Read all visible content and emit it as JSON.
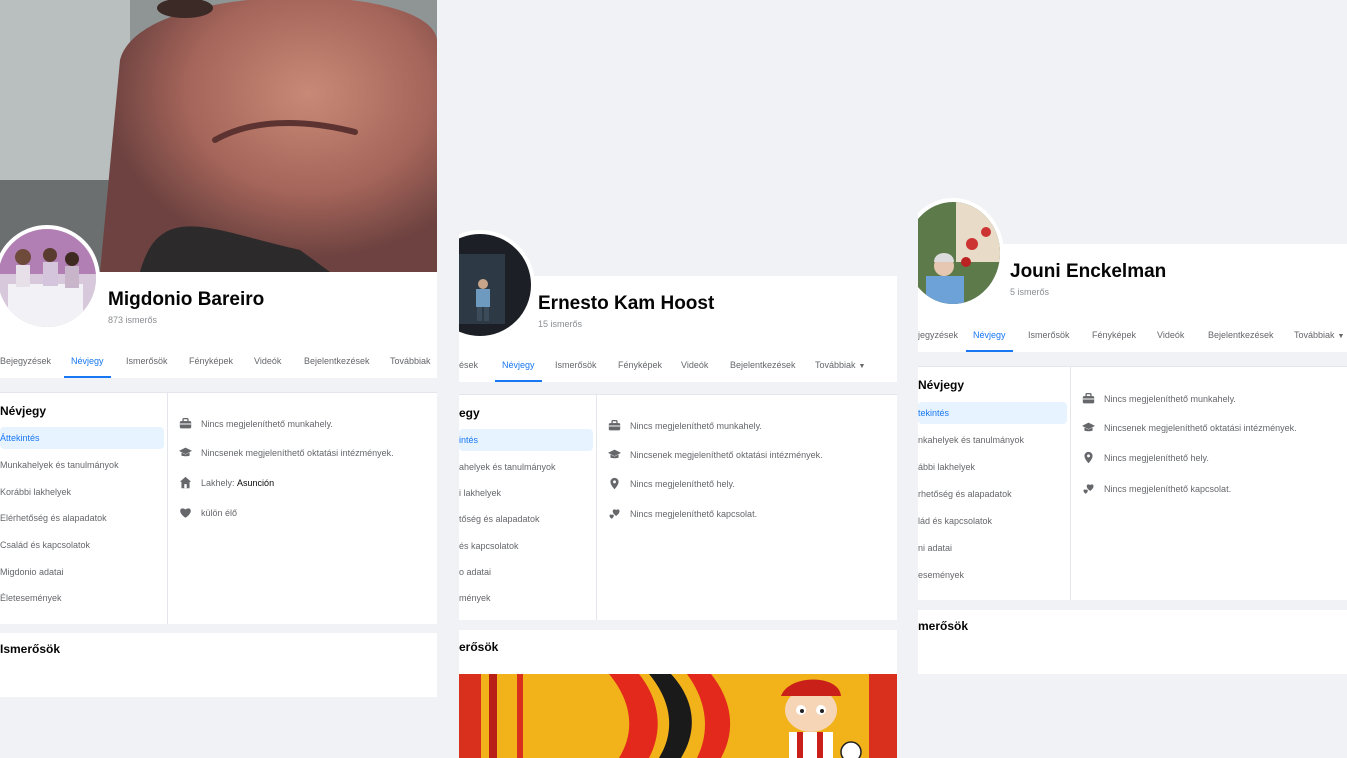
{
  "profiles": [
    {
      "name": "Migdonio Bareiro",
      "friends_count": "873 ismerős",
      "tabs": [
        "Bejegyzések",
        "Névjegy",
        "Ismerősök",
        "Fényképek",
        "Videók",
        "Bejelentkezések",
        "Továbbiak"
      ],
      "about_title": "Névjegy",
      "side_items": [
        "Áttekintés",
        "Munkahelyek és tanulmányok",
        "Korábbi lakhelyek",
        "Elérhetőség és alapadatok",
        "Család és kapcsolatok",
        "Migdonio adatai",
        "Életesemények"
      ],
      "info": [
        {
          "icon": "briefcase-icon",
          "text": "Nincs megjeleníthető munkahely."
        },
        {
          "icon": "graduation-cap-icon",
          "text": "Nincsenek megjeleníthető oktatási intézmények."
        },
        {
          "icon": "home-icon",
          "text": "Lakhely:",
          "value": "Asunción"
        },
        {
          "icon": "heart-icon",
          "text": "külön élő"
        }
      ],
      "friends_section": "Ismerősök"
    },
    {
      "name": "Ernesto Kam Hoost",
      "friends_count": "15 ismerős",
      "tabs": [
        "ések",
        "Névjegy",
        "Ismerősök",
        "Fényképek",
        "Videók",
        "Bejelentkezések",
        "Továbbiak"
      ],
      "about_title": "egy",
      "side_items": [
        "intés",
        "ahelyek és tanulmányok",
        "i lakhelyek",
        "tőség és alapadatok",
        "és kapcsolatok",
        "o adatai",
        "mények"
      ],
      "info": [
        {
          "icon": "briefcase-icon",
          "text": "Nincs megjeleníthető munkahely."
        },
        {
          "icon": "graduation-cap-icon",
          "text": "Nincsenek megjeleníthető oktatási intézmények."
        },
        {
          "icon": "location-pin-icon",
          "text": "Nincs megjeleníthető hely."
        },
        {
          "icon": "relationship-hearts-icon",
          "text": "Nincs megjeleníthető kapcsolat."
        }
      ],
      "friends_section": "erősök"
    },
    {
      "name": "Jouni Enckelman",
      "friends_count": "5 ismerős",
      "tabs": [
        "jegyzések",
        "Névjegy",
        "Ismerősök",
        "Fényképek",
        "Videók",
        "Bejelentkezések",
        "Továbbiak"
      ],
      "about_title": "Névjegy",
      "side_items": [
        "tekintés",
        "nkahelyek és tanulmányok",
        "ábbi lakhelyek",
        "rhetőség és alapadatok",
        "lád és kapcsolatok",
        "ni adatai",
        "események"
      ],
      "info": [
        {
          "icon": "briefcase-icon",
          "text": "Nincs megjeleníthető munkahely."
        },
        {
          "icon": "graduation-cap-icon",
          "text": "Nincsenek megjeleníthető oktatási intézmények."
        },
        {
          "icon": "location-pin-icon",
          "text": "Nincs megjeleníthető hely."
        },
        {
          "icon": "relationship-hearts-icon",
          "text": "Nincs megjeleníthető kapcsolat."
        }
      ],
      "friends_section": "merősök"
    }
  ],
  "colors": {
    "accent": "#1877f2",
    "muted_text": "#65676b",
    "page_bg": "#f0f2f5"
  }
}
